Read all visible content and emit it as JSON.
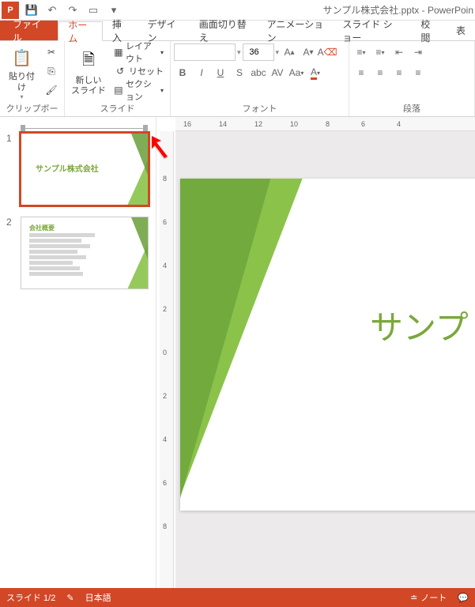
{
  "title": "サンプル株式会社.pptx - PowerPoin",
  "tabs": {
    "file": "ファイル",
    "home": "ホーム",
    "insert": "挿入",
    "design": "デザイン",
    "transitions": "画面切り替え",
    "animations": "アニメーション",
    "slideshow": "スライド ショー",
    "review": "校閲",
    "view": "表"
  },
  "ribbon": {
    "clipboard": {
      "label": "クリップボード",
      "paste": "貼り付け"
    },
    "slides": {
      "label": "スライド",
      "newslide": "新しい\nスライド",
      "layout": "レイアウト",
      "reset": "リセット",
      "section": "セクション"
    },
    "font": {
      "label": "フォント",
      "size": "36"
    },
    "paragraph": {
      "label": "段落"
    }
  },
  "ruler_h": [
    "16",
    "14",
    "12",
    "10",
    "8",
    "6",
    "4"
  ],
  "ruler_v": [
    "8",
    "6",
    "4",
    "2",
    "0",
    "2",
    "4",
    "6",
    "8"
  ],
  "thumbs": {
    "t1": {
      "num": "1",
      "title": "サンプル株式会社"
    },
    "t2": {
      "num": "2",
      "title": "会社概要"
    }
  },
  "slide": {
    "title": "サンプ"
  },
  "status": {
    "slide": "スライド 1/2",
    "lang": "日本語",
    "notes": "ノート"
  }
}
